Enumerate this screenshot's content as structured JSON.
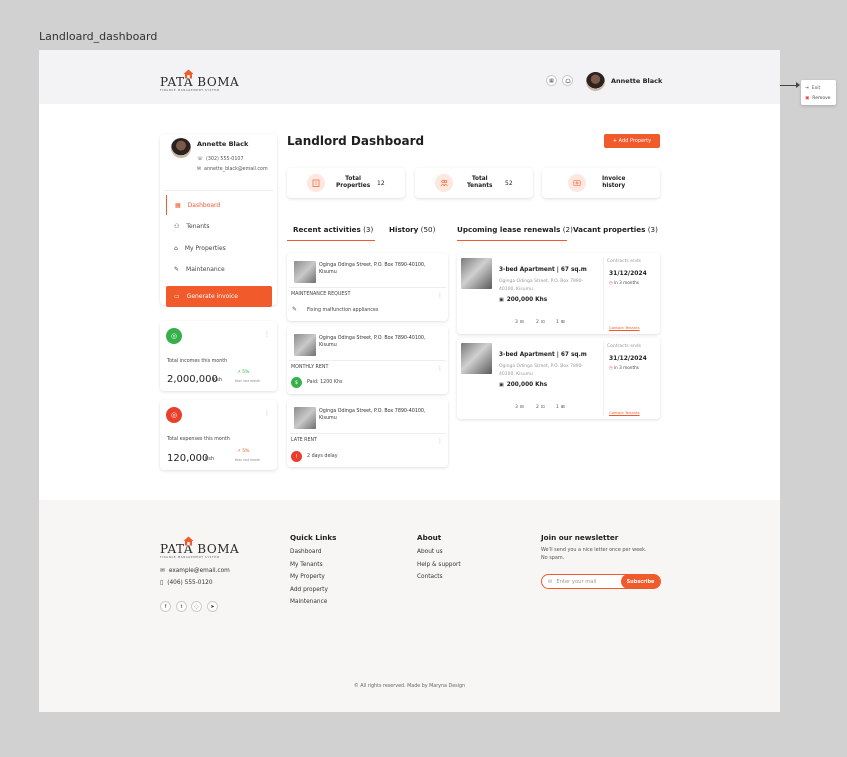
{
  "frame_label": "Landloard_dashboard",
  "brand": {
    "name": "PATA BOMA",
    "tagline": "FINANCE MANAGEMENT SYSTEM"
  },
  "header": {
    "user_name": "Annette Black"
  },
  "context_menu": {
    "items": [
      "Exit",
      "Remove"
    ]
  },
  "profile": {
    "name": "Annette Black",
    "phone": "(302) 555-0107",
    "email": "annette_black@email.com"
  },
  "sidebar": {
    "items": [
      {
        "label": "Dashboard",
        "icon": "grid-icon"
      },
      {
        "label": "Tenants",
        "icon": "people-icon"
      },
      {
        "label": "My Properties",
        "icon": "home-icon"
      },
      {
        "label": "Maintenance",
        "icon": "wrench-icon"
      }
    ],
    "generate_label": "Generate invoice"
  },
  "finance": {
    "income": {
      "label": "Total incomes this month",
      "amount": "2,000,000",
      "currency": "Ksh",
      "change": "5%",
      "change_sub": "than last month",
      "color": "#35b04a"
    },
    "expenses": {
      "label": "Total expenses this month",
      "amount": "120,000",
      "currency": "Ksh",
      "change": "5%",
      "change_sub": "than last month",
      "color": "#e8402c"
    }
  },
  "main": {
    "title": "Landlord Dashboard",
    "add_button": "+ Add Property",
    "stats": [
      {
        "label_line1": "Total",
        "label_line2": "Properties",
        "value": "12"
      },
      {
        "label_line1": "Total",
        "label_line2": "Tenants",
        "value": "52"
      },
      {
        "label_line1": "Invoice",
        "label_line2": "history",
        "value": ""
      }
    ],
    "tabs": [
      {
        "label": "Recent activities",
        "count": "(3)"
      },
      {
        "label": "History",
        "count": "(50)"
      },
      {
        "label": "Upcoming lease renewals",
        "count": "(2)"
      },
      {
        "label": "Vacant properties",
        "count": "(3)"
      }
    ],
    "activities": [
      {
        "address": "Oginga Odinga Street, P.O. Box 7890-40100, Kisumu",
        "type": "MAINTENANCE REQUEST",
        "note": "Fixing malfunction appliances"
      },
      {
        "address": "Oginga Odinga Street, P.O. Box 7890-40100, Kisumu",
        "type": "MONTHLY RENT",
        "note": "Paid: 1200 Khs"
      },
      {
        "address": "Oginga Odinga Street, P.O. Box 7890-40100, Kisumu",
        "type": "LATE RENT",
        "note": "2 days delay"
      }
    ],
    "leases": [
      {
        "title": "3-bed Apartment | 67 sq.m",
        "address": "Oginga Odinga Street, P.O. Box 7890-40100, Kisumu",
        "price": "200,000 Khs",
        "contract_label": "Contracts ends",
        "date": "31/12/2024",
        "in": "in 3 months",
        "beds": "3",
        "baths": "2",
        "parking": "1",
        "contact": "Contact Tenants"
      },
      {
        "title": "3-bed Apartment | 67 sq.m",
        "address": "Oginga Odinga Street, P.O. Box 7890-40100, Kisumu",
        "price": "200,000 Khs",
        "contract_label": "Contracts ends",
        "date": "31/12/2024",
        "in": "in 3 months",
        "beds": "3",
        "baths": "2",
        "parking": "1",
        "contact": "Contact Tenants"
      }
    ]
  },
  "footer": {
    "email": "example@email.com",
    "phone": "(406) 555-0120",
    "quick_links": {
      "title": "Quick Links",
      "items": [
        "Dashboard",
        "My Tenants",
        "My Property",
        "Add property",
        "Maintenance"
      ]
    },
    "about": {
      "title": "About",
      "items": [
        "About us",
        "Help & support",
        "Contacts"
      ]
    },
    "newsletter": {
      "title": "Join our newsletter",
      "desc": "We'll send you a nice letter once per week. No spam.",
      "placeholder": "Enter your mail",
      "button": "Subscribe"
    },
    "copyright": "© All rights reserved. Made by Maryna Design"
  },
  "colors": {
    "accent": "#f15a2b",
    "green": "#35b04a",
    "red": "#e8402c",
    "header_bg": "#f3f3f5",
    "footer_bg": "#f7f6f4"
  }
}
